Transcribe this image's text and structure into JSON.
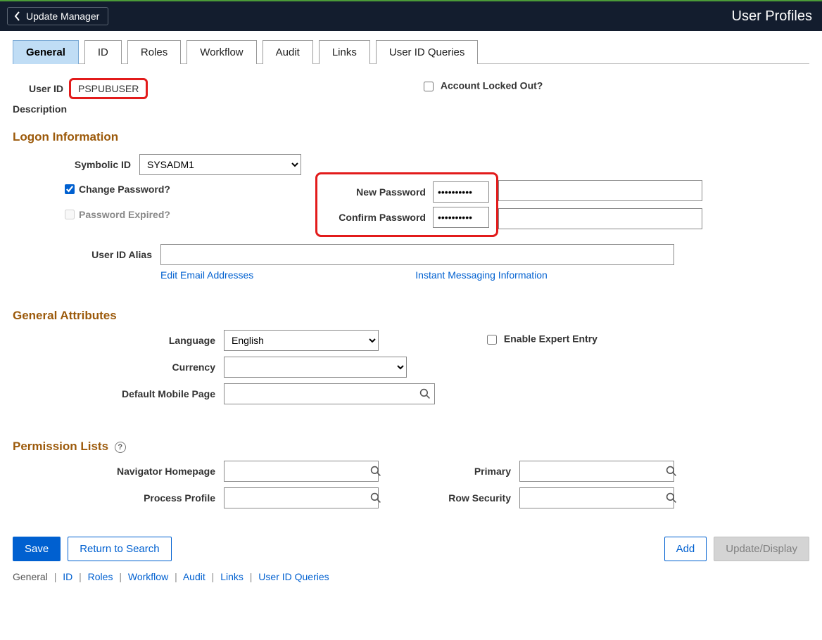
{
  "header": {
    "back_label": "Update Manager",
    "title": "User Profiles"
  },
  "tabs": [
    "General",
    "ID",
    "Roles",
    "Workflow",
    "Audit",
    "Links",
    "User ID Queries"
  ],
  "top": {
    "userid_label": "User ID",
    "userid_value": "PSPUBUSER",
    "description_label": "Description",
    "account_locked_label": "Account Locked Out?"
  },
  "logon": {
    "section_title": "Logon Information",
    "symbolic_id_label": "Symbolic ID",
    "symbolic_id_value": "SYSADM1",
    "change_pw_label": "Change Password?",
    "pw_expired_label": "Password Expired?",
    "new_pw_label": "New Password",
    "new_pw_value": "••••••••••",
    "confirm_pw_label": "Confirm Password",
    "confirm_pw_value": "••••••••••",
    "user_id_alias_label": "User ID Alias",
    "user_id_alias_value": "",
    "edit_email_link": "Edit Email Addresses",
    "im_info_link": "Instant Messaging Information"
  },
  "general_attrs": {
    "section_title": "General Attributes",
    "language_label": "Language",
    "language_value": "English",
    "currency_label": "Currency",
    "currency_value": "",
    "default_mobile_label": "Default Mobile Page",
    "default_mobile_value": "",
    "enable_expert_label": "Enable Expert Entry"
  },
  "permission": {
    "section_title": "Permission Lists",
    "help": "?",
    "nav_homepage_label": "Navigator Homepage",
    "nav_homepage_value": "",
    "process_profile_label": "Process Profile",
    "process_profile_value": "",
    "primary_label": "Primary",
    "primary_value": "",
    "row_security_label": "Row Security",
    "row_security_value": ""
  },
  "buttons": {
    "save": "Save",
    "return_to_search": "Return to Search",
    "add": "Add",
    "update_display": "Update/Display"
  },
  "bottom_links": [
    "General",
    "ID",
    "Roles",
    "Workflow",
    "Audit",
    "Links",
    "User ID Queries"
  ]
}
